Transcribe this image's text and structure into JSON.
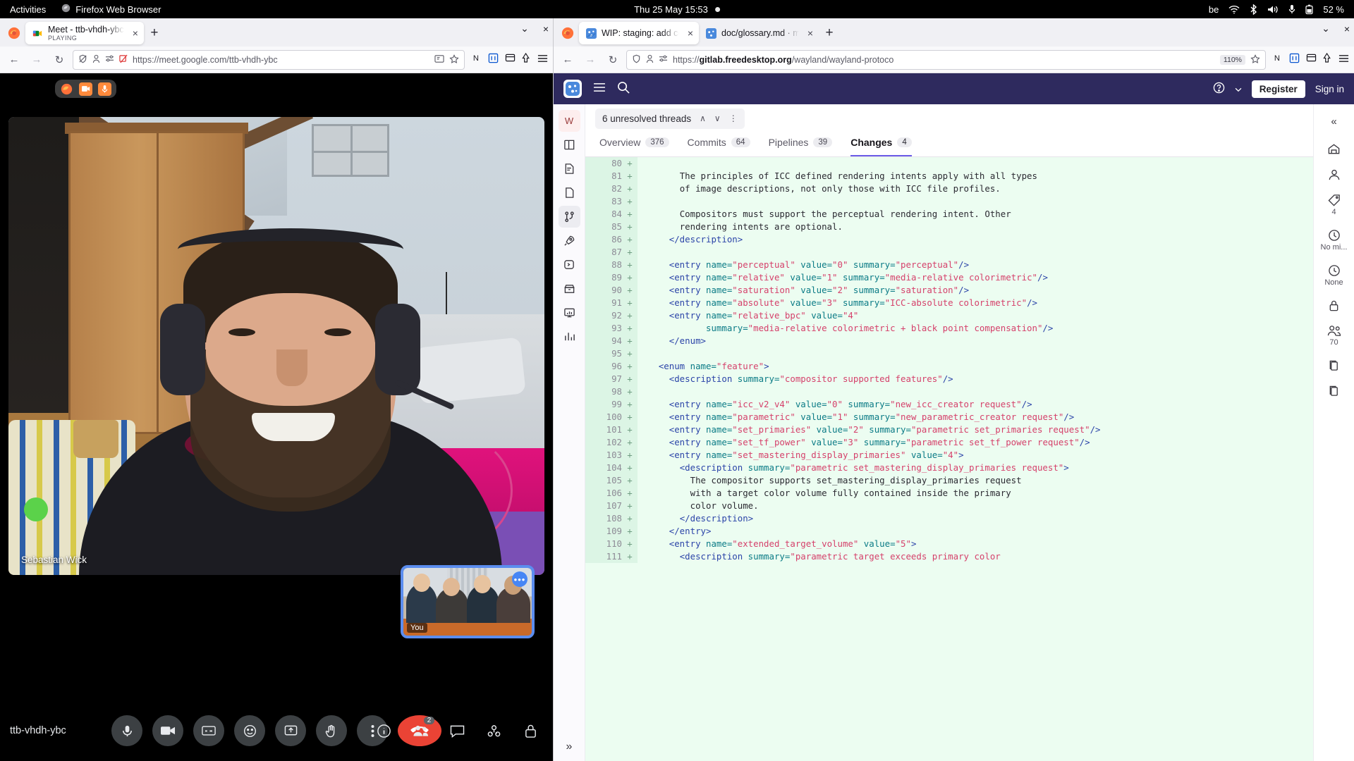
{
  "topbar": {
    "activities": "Activities",
    "app_name": "Firefox Web Browser",
    "clock": "Thu 25 May  15:53",
    "keyboard_layout": "be",
    "battery": "52 %",
    "icons": [
      "wifi-icon",
      "bluetooth-icon",
      "volume-icon",
      "microphone-icon",
      "battery-icon"
    ]
  },
  "left_window": {
    "tab": {
      "title": "Meet - ttb-vhdh-ybc",
      "status": "PLAYING",
      "close": "×"
    },
    "newtab": "+",
    "window_controls": {
      "minimize": "⌄",
      "close": "×"
    },
    "nav": {
      "back": "←",
      "forward": "→",
      "reload": "↻"
    },
    "url": "https://meet.google.com/ttb-vhdh-ybc",
    "toolbar_icons": [
      "shield-icon",
      "account-icon",
      "permissions-icon",
      "popup-blocked-icon",
      "reader-icon",
      "bookmark-star-icon",
      "container-icon",
      "pocket-icon",
      "save-to-pocket-icon",
      "extensions-icon",
      "menu-icon"
    ]
  },
  "meet": {
    "pill_icons": [
      "firefox-icon",
      "camera-icon",
      "microphone-icon"
    ],
    "participant_name": "Sebastian Wick",
    "selfview": {
      "label": "You",
      "more": "•••"
    },
    "meeting_code": "ttb-vhdh-ybc",
    "controls": [
      {
        "name": "microphone-button",
        "glyph": "mic"
      },
      {
        "name": "camera-button",
        "glyph": "cam"
      },
      {
        "name": "captions-button",
        "glyph": "cc"
      },
      {
        "name": "emoji-button",
        "glyph": "emoji"
      },
      {
        "name": "present-button",
        "glyph": "present"
      },
      {
        "name": "raise-hand-button",
        "glyph": "hand"
      },
      {
        "name": "more-options-button",
        "glyph": "dots"
      },
      {
        "name": "leave-call-button",
        "glyph": "hangup"
      }
    ],
    "right_controls": [
      {
        "name": "meeting-details-button",
        "glyph": "info",
        "badge": ""
      },
      {
        "name": "participants-button",
        "glyph": "people",
        "badge": "2"
      },
      {
        "name": "chat-button",
        "glyph": "chat",
        "badge": ""
      },
      {
        "name": "activities-button",
        "glyph": "activities",
        "badge": ""
      },
      {
        "name": "host-controls-button",
        "glyph": "lock",
        "badge": ""
      }
    ]
  },
  "right_window": {
    "tabs": [
      {
        "title": "WIP: staging: add color m",
        "active": true,
        "close": "×"
      },
      {
        "title": "doc/glossary.md · main · P",
        "active": false,
        "close": "×"
      }
    ],
    "newtab": "+",
    "window_controls": {
      "minimize": "⌄",
      "close": "×"
    },
    "url_prefix": "https://",
    "url_host": "gitlab.freedesktop.org",
    "url_path": "/wayland/wayland-protoco",
    "zoom": "110%"
  },
  "gitlab": {
    "header": {
      "logo": "gitlab-logo-icon",
      "menu": "hamburger-icon",
      "search": "search-icon",
      "help": "help-icon",
      "register": "Register",
      "signin": "Sign in"
    },
    "left_rail": [
      {
        "name": "project-avatar",
        "label": "W"
      },
      {
        "name": "sidebar-item-overview",
        "label": ""
      },
      {
        "name": "sidebar-item-issues",
        "label": ""
      },
      {
        "name": "sidebar-item-repository",
        "label": ""
      },
      {
        "name": "sidebar-item-merge-requests",
        "label": "",
        "selected": true
      },
      {
        "name": "sidebar-item-deployments",
        "label": ""
      },
      {
        "name": "sidebar-item-ci-cd",
        "label": ""
      },
      {
        "name": "sidebar-item-packages",
        "label": ""
      },
      {
        "name": "sidebar-item-monitor",
        "label": ""
      },
      {
        "name": "sidebar-item-analytics",
        "label": ""
      }
    ],
    "threads": {
      "text": "6 unresolved threads",
      "prev": "∧",
      "next": "∨",
      "more": "⋮"
    },
    "tabs": [
      {
        "label": "Overview",
        "count": "376",
        "active": false
      },
      {
        "label": "Commits",
        "count": "64",
        "active": false
      },
      {
        "label": "Pipelines",
        "count": "39",
        "active": false
      },
      {
        "label": "Changes",
        "count": "4",
        "active": true
      }
    ],
    "right_rail": [
      {
        "name": "todo-icon",
        "value": ""
      },
      {
        "name": "assignee-icon",
        "value": ""
      },
      {
        "name": "labels-icon",
        "value": "4"
      },
      {
        "name": "time-tracking-icon",
        "value": "No mi..."
      },
      {
        "name": "milestone-icon",
        "value": "None"
      },
      {
        "name": "lock-icon",
        "value": ""
      },
      {
        "name": "participants-icon",
        "value": "70"
      },
      {
        "name": "copy-branch-icon",
        "value": ""
      },
      {
        "name": "copy-reference-icon",
        "value": ""
      }
    ],
    "collapse": "«",
    "expand": "»"
  },
  "diff": [
    {
      "line": "80",
      "sign": "+",
      "segments": []
    },
    {
      "line": "81",
      "sign": "+",
      "segments": [
        {
          "t": "plain",
          "v": "        The principles of ICC defined rendering intents apply with all types"
        }
      ]
    },
    {
      "line": "82",
      "sign": "+",
      "segments": [
        {
          "t": "plain",
          "v": "        of image descriptions, not only those with ICC file profiles."
        }
      ]
    },
    {
      "line": "83",
      "sign": "+",
      "segments": []
    },
    {
      "line": "84",
      "sign": "+",
      "segments": [
        {
          "t": "plain",
          "v": "        Compositors must support the perceptual rendering intent. Other"
        }
      ]
    },
    {
      "line": "85",
      "sign": "+",
      "segments": [
        {
          "t": "plain",
          "v": "        rendering intents are optional."
        }
      ]
    },
    {
      "line": "86",
      "sign": "+",
      "segments": [
        {
          "t": "tag",
          "v": "      </description>"
        }
      ]
    },
    {
      "line": "87",
      "sign": "+",
      "segments": []
    },
    {
      "line": "88",
      "sign": "+",
      "segments": [
        {
          "t": "tag",
          "v": "      <entry "
        },
        {
          "t": "attr",
          "v": "name="
        },
        {
          "t": "str",
          "v": "\"perceptual\""
        },
        {
          "t": "attr",
          "v": " value="
        },
        {
          "t": "str",
          "v": "\"0\""
        },
        {
          "t": "attr",
          "v": " summary="
        },
        {
          "t": "str",
          "v": "\"perceptual\""
        },
        {
          "t": "tag",
          "v": "/>"
        }
      ]
    },
    {
      "line": "89",
      "sign": "+",
      "segments": [
        {
          "t": "tag",
          "v": "      <entry "
        },
        {
          "t": "attr",
          "v": "name="
        },
        {
          "t": "str",
          "v": "\"relative\""
        },
        {
          "t": "attr",
          "v": " value="
        },
        {
          "t": "str",
          "v": "\"1\""
        },
        {
          "t": "attr",
          "v": " summary="
        },
        {
          "t": "str",
          "v": "\"media-relative colorimetric\""
        },
        {
          "t": "tag",
          "v": "/>"
        }
      ]
    },
    {
      "line": "90",
      "sign": "+",
      "segments": [
        {
          "t": "tag",
          "v": "      <entry "
        },
        {
          "t": "attr",
          "v": "name="
        },
        {
          "t": "str",
          "v": "\"saturation\""
        },
        {
          "t": "attr",
          "v": " value="
        },
        {
          "t": "str",
          "v": "\"2\""
        },
        {
          "t": "attr",
          "v": " summary="
        },
        {
          "t": "str",
          "v": "\"saturation\""
        },
        {
          "t": "tag",
          "v": "/>"
        }
      ]
    },
    {
      "line": "91",
      "sign": "+",
      "segments": [
        {
          "t": "tag",
          "v": "      <entry "
        },
        {
          "t": "attr",
          "v": "name="
        },
        {
          "t": "str",
          "v": "\"absolute\""
        },
        {
          "t": "attr",
          "v": " value="
        },
        {
          "t": "str",
          "v": "\"3\""
        },
        {
          "t": "attr",
          "v": " summary="
        },
        {
          "t": "str",
          "v": "\"ICC-absolute colorimetric\""
        },
        {
          "t": "tag",
          "v": "/>"
        }
      ]
    },
    {
      "line": "92",
      "sign": "+",
      "segments": [
        {
          "t": "tag",
          "v": "      <entry "
        },
        {
          "t": "attr",
          "v": "name="
        },
        {
          "t": "str",
          "v": "\"relative_bpc\""
        },
        {
          "t": "attr",
          "v": " value="
        },
        {
          "t": "str",
          "v": "\"4\""
        }
      ]
    },
    {
      "line": "93",
      "sign": "+",
      "segments": [
        {
          "t": "attr",
          "v": "             summary="
        },
        {
          "t": "str",
          "v": "\"media-relative colorimetric + black point compensation\""
        },
        {
          "t": "tag",
          "v": "/>"
        }
      ]
    },
    {
      "line": "94",
      "sign": "+",
      "segments": [
        {
          "t": "tag",
          "v": "      </enum>"
        }
      ]
    },
    {
      "line": "95",
      "sign": "+",
      "segments": []
    },
    {
      "line": "96",
      "sign": "+",
      "segments": [
        {
          "t": "tag",
          "v": "    <enum "
        },
        {
          "t": "attr",
          "v": "name="
        },
        {
          "t": "str",
          "v": "\"feature\""
        },
        {
          "t": "tag",
          "v": ">"
        }
      ]
    },
    {
      "line": "97",
      "sign": "+",
      "segments": [
        {
          "t": "tag",
          "v": "      <description "
        },
        {
          "t": "attr",
          "v": "summary="
        },
        {
          "t": "str",
          "v": "\"compositor supported features\""
        },
        {
          "t": "tag",
          "v": "/>"
        }
      ]
    },
    {
      "line": "98",
      "sign": "+",
      "segments": []
    },
    {
      "line": "99",
      "sign": "+",
      "segments": [
        {
          "t": "tag",
          "v": "      <entry "
        },
        {
          "t": "attr",
          "v": "name="
        },
        {
          "t": "str",
          "v": "\"icc_v2_v4\""
        },
        {
          "t": "attr",
          "v": " value="
        },
        {
          "t": "str",
          "v": "\"0\""
        },
        {
          "t": "attr",
          "v": " summary="
        },
        {
          "t": "str",
          "v": "\"new_icc_creator request\""
        },
        {
          "t": "tag",
          "v": "/>"
        }
      ]
    },
    {
      "line": "100",
      "sign": "+",
      "segments": [
        {
          "t": "tag",
          "v": "      <entry "
        },
        {
          "t": "attr",
          "v": "name="
        },
        {
          "t": "str",
          "v": "\"parametric\""
        },
        {
          "t": "attr",
          "v": " value="
        },
        {
          "t": "str",
          "v": "\"1\""
        },
        {
          "t": "attr",
          "v": " summary="
        },
        {
          "t": "str",
          "v": "\"new_parametric_creator request\""
        },
        {
          "t": "tag",
          "v": "/>"
        }
      ]
    },
    {
      "line": "101",
      "sign": "+",
      "segments": [
        {
          "t": "tag",
          "v": "      <entry "
        },
        {
          "t": "attr",
          "v": "name="
        },
        {
          "t": "str",
          "v": "\"set_primaries\""
        },
        {
          "t": "attr",
          "v": " value="
        },
        {
          "t": "str",
          "v": "\"2\""
        },
        {
          "t": "attr",
          "v": " summary="
        },
        {
          "t": "str",
          "v": "\"parametric set_primaries request\""
        },
        {
          "t": "tag",
          "v": "/>"
        }
      ]
    },
    {
      "line": "102",
      "sign": "+",
      "segments": [
        {
          "t": "tag",
          "v": "      <entry "
        },
        {
          "t": "attr",
          "v": "name="
        },
        {
          "t": "str",
          "v": "\"set_tf_power\""
        },
        {
          "t": "attr",
          "v": " value="
        },
        {
          "t": "str",
          "v": "\"3\""
        },
        {
          "t": "attr",
          "v": " summary="
        },
        {
          "t": "str",
          "v": "\"parametric set_tf_power request\""
        },
        {
          "t": "tag",
          "v": "/>"
        }
      ]
    },
    {
      "line": "103",
      "sign": "+",
      "segments": [
        {
          "t": "tag",
          "v": "      <entry "
        },
        {
          "t": "attr",
          "v": "name="
        },
        {
          "t": "str",
          "v": "\"set_mastering_display_primaries\""
        },
        {
          "t": "attr",
          "v": " value="
        },
        {
          "t": "str",
          "v": "\"4\""
        },
        {
          "t": "tag",
          "v": ">"
        }
      ]
    },
    {
      "line": "104",
      "sign": "+",
      "segments": [
        {
          "t": "tag",
          "v": "        <description "
        },
        {
          "t": "attr",
          "v": "summary="
        },
        {
          "t": "str",
          "v": "\"parametric set_mastering_display_primaries request\""
        },
        {
          "t": "tag",
          "v": ">"
        }
      ]
    },
    {
      "line": "105",
      "sign": "+",
      "segments": [
        {
          "t": "plain",
          "v": "          The compositor supports set_mastering_display_primaries request"
        }
      ]
    },
    {
      "line": "106",
      "sign": "+",
      "segments": [
        {
          "t": "plain",
          "v": "          with a target color volume fully contained inside the primary"
        }
      ]
    },
    {
      "line": "107",
      "sign": "+",
      "segments": [
        {
          "t": "plain",
          "v": "          color volume."
        }
      ]
    },
    {
      "line": "108",
      "sign": "+",
      "segments": [
        {
          "t": "tag",
          "v": "        </description>"
        }
      ]
    },
    {
      "line": "109",
      "sign": "+",
      "segments": [
        {
          "t": "tag",
          "v": "      </entry>"
        }
      ]
    },
    {
      "line": "110",
      "sign": "+",
      "segments": [
        {
          "t": "tag",
          "v": "      <entry "
        },
        {
          "t": "attr",
          "v": "name="
        },
        {
          "t": "str",
          "v": "\"extended_target_volume\""
        },
        {
          "t": "attr",
          "v": " value="
        },
        {
          "t": "str",
          "v": "\"5\""
        },
        {
          "t": "tag",
          "v": ">"
        }
      ]
    },
    {
      "line": "111",
      "sign": "+",
      "segments": [
        {
          "t": "tag",
          "v": "        <description "
        },
        {
          "t": "attr",
          "v": "summary="
        },
        {
          "t": "str",
          "v": "\"parametric target exceeds primary color"
        }
      ]
    }
  ]
}
